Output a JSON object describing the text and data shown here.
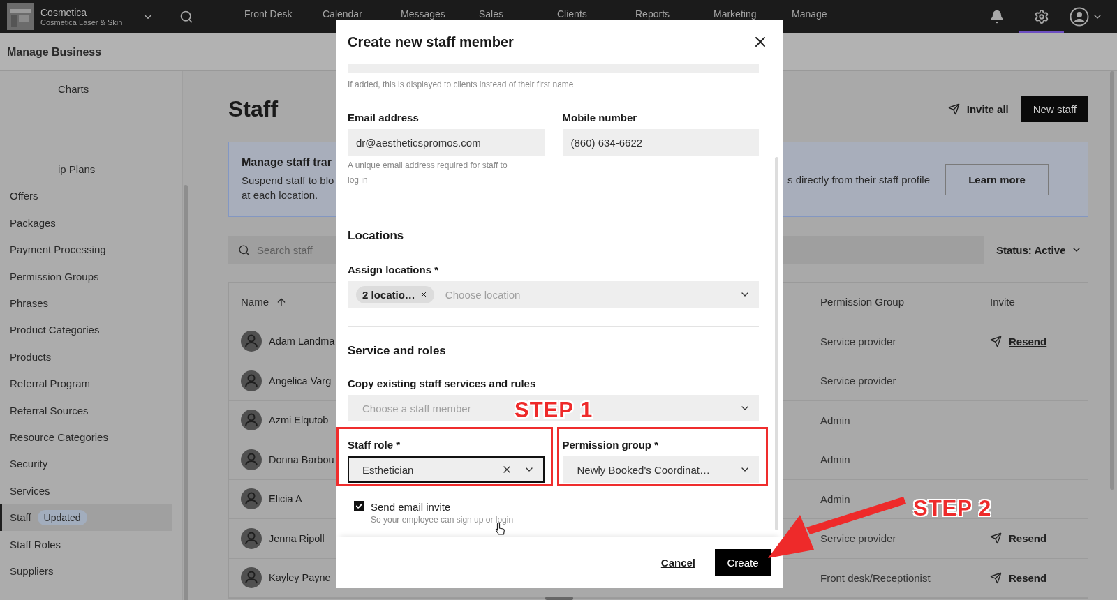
{
  "top_bar": {
    "business_name": "Cosmetica",
    "business_subtitle": "Cosmetica Laser & Skin",
    "nav": [
      "Front Desk",
      "Calendar",
      "Messages",
      "Sales",
      "Clients",
      "Reports",
      "Marketing",
      "Manage"
    ],
    "icons": [
      {
        "kind": "bell",
        "selected": false
      },
      {
        "kind": "settings",
        "selected": true
      },
      {
        "kind": "account",
        "selected": false
      }
    ]
  },
  "page_header": "Manage Business",
  "sidebar": {
    "items": [
      {
        "label": "Charts",
        "kind": "partial",
        "selected": false
      },
      {
        "label": "ip Plans",
        "kind": "partial",
        "selected": false
      },
      {
        "label": "Offers",
        "selected": false
      },
      {
        "label": "Packages",
        "selected": false
      },
      {
        "label": "Payment Processing",
        "selected": false
      },
      {
        "label": "Permission Groups",
        "selected": false
      },
      {
        "label": "Phrases",
        "selected": false
      },
      {
        "label": "Product Categories",
        "selected": false
      },
      {
        "label": "Products",
        "selected": false
      },
      {
        "label": "Referral Program",
        "selected": false
      },
      {
        "label": "Referral Sources",
        "selected": false
      },
      {
        "label": "Resource Categories",
        "selected": false
      },
      {
        "label": "Security",
        "selected": false
      },
      {
        "label": "Services",
        "selected": false
      },
      {
        "label": "Staff",
        "badge": "Updated",
        "selected": true
      },
      {
        "label": "Staff Roles",
        "selected": false
      },
      {
        "label": "Suppliers",
        "selected": false
      }
    ]
  },
  "main": {
    "title": "Staff",
    "invite_all": "Invite all",
    "new_staff": "New staff",
    "banner": {
      "title": "Manage staff trar",
      "lines": [
        "Suspend staff to blo",
        "at each location."
      ],
      "right_text": "s directly from their staff profile",
      "button": "Learn more"
    },
    "search": {
      "placeholder": "Search staff"
    },
    "status_filter": "Status: Active",
    "table": {
      "columns": [
        {
          "label": "Name",
          "sorted": true
        },
        {
          "label": "Permission Group",
          "sorted": false
        },
        {
          "label": "Invite",
          "sorted": false
        }
      ],
      "rows": [
        {
          "name": "Adam Landma",
          "permission_group": "Service provider",
          "invite": "Resend"
        },
        {
          "name": "Angelica Varg",
          "permission_group": "Service provider"
        },
        {
          "name": "Azmi Elqutob",
          "permission_group": "Admin"
        },
        {
          "name": "Donna Barbou",
          "permission_group": "Admin"
        },
        {
          "name": "Elicia A",
          "permission_group": "Admin"
        },
        {
          "name": "Jenna Ripoll",
          "permission_group": "Service provider",
          "invite": "Resend"
        },
        {
          "name": "Kayley Payne",
          "permission_group": "Front desk/Receptionist",
          "invite": "Resend"
        }
      ]
    }
  },
  "modal": {
    "title": "Create new staff member",
    "top_hint": "If added, this is displayed to clients instead of their first name",
    "email": {
      "label": "Email address",
      "value": "dr@aestheticspromos.com",
      "hint": "A unique email address required for staff to log in"
    },
    "mobile": {
      "label": "Mobile number",
      "value": "(860) 634-6622"
    },
    "locations": {
      "heading": "Locations",
      "label": "Assign locations *",
      "chip": "2 locatio…",
      "placeholder": "Choose location"
    },
    "services": {
      "heading": "Service and roles",
      "copy_label": "Copy existing staff services and rules",
      "copy_placeholder": "Choose a staff member"
    },
    "staff_role": {
      "label": "Staff role *",
      "value": "Esthetician",
      "focused": true
    },
    "permission_group": {
      "label": "Permission group *",
      "value": "Newly Booked's Coordinat…",
      "focused": false
    },
    "send_invite": {
      "label": "Send email invite",
      "hint": "So your employee can sign up or login",
      "checked": true
    },
    "cancel": "Cancel",
    "create": "Create"
  },
  "annotations": [
    {
      "text": "STEP 1"
    },
    {
      "text": "STEP 2"
    }
  ]
}
